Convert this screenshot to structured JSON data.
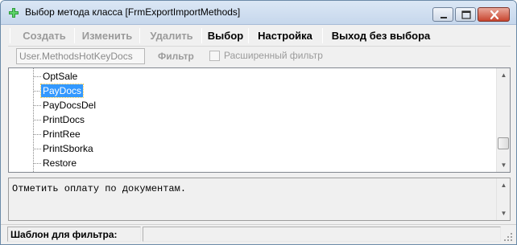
{
  "window": {
    "title": "Выбор метода класса [FrmExportImportMethods]",
    "icon": "green-plus-icon",
    "controls": [
      "minimize-icon",
      "maximize-icon",
      "close-icon"
    ]
  },
  "toolbar": {
    "create_label": "Создать",
    "edit_label": "Изменить",
    "delete_label": "Удалить",
    "select_label": "Выбор",
    "settings_label": "Настройка",
    "exit_label": "Выход без выбора"
  },
  "filter": {
    "input_value": "User.MethodsHotKeyDocs",
    "filter_button_label": "Фильтр",
    "advanced_checkbox_label": "Расширенный фильтр",
    "advanced_checked": false
  },
  "tree": {
    "items": [
      {
        "label": "OptSale",
        "selected": false
      },
      {
        "label": "PayDocs",
        "selected": true
      },
      {
        "label": "PayDocsDel",
        "selected": false
      },
      {
        "label": "PrintDocs",
        "selected": false
      },
      {
        "label": "PrintRee",
        "selected": false
      },
      {
        "label": "PrintSborka",
        "selected": false
      },
      {
        "label": "Restore",
        "selected": false
      }
    ],
    "selected_color": "#3399ff",
    "scroll_position": 0.75
  },
  "description": {
    "text": "Отметить оплату по документам."
  },
  "status": {
    "filter_template_label": "Шаблон для фильтра:",
    "filter_template_value": ""
  }
}
